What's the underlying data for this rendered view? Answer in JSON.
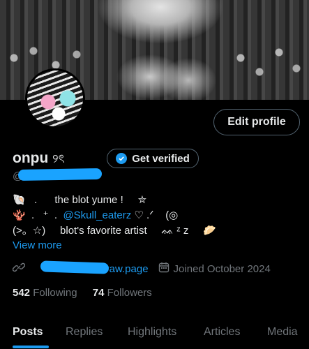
{
  "profile": {
    "name": "onpu",
    "name_glyph": "୨ৎ",
    "edit_label": "Edit profile",
    "verify_label": "Get verified",
    "bio": {
      "line1": "🐚   .      the blot yume !     ✮",
      "line2_prefix": "🪸  .   ⁺  .  ",
      "line2_mention": "@Skull_eaterz",
      "line2_suffix": " ♡ .ᐟ    (◎",
      "line3": "(>。☆)     blot's favorite artist     ᨐ ᶻ z     🥟"
    },
    "view_more": "View more",
    "website": "straw.page",
    "joined": "Joined October 2024",
    "following_count": "542",
    "following_label": "Following",
    "followers_count": "74",
    "followers_label": "Followers"
  },
  "tabs": [
    "Posts",
    "Replies",
    "Highlights",
    "Articles",
    "Media"
  ],
  "colors": {
    "accent": "#1d9bf0",
    "muted": "#71767b",
    "text": "#e7e9ea"
  }
}
